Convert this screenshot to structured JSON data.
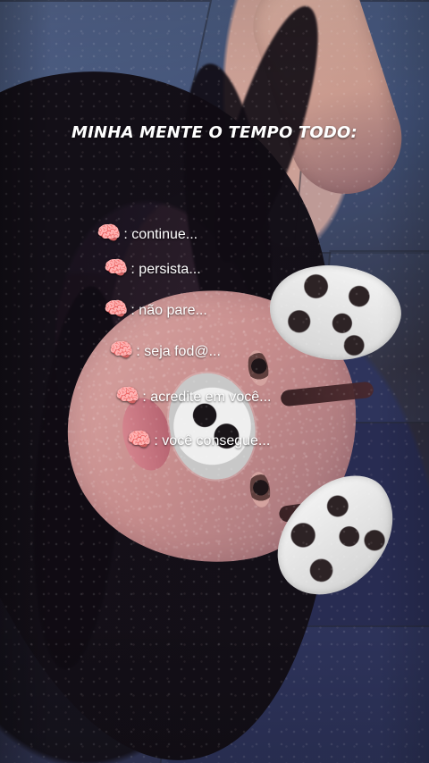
{
  "story": {
    "title": "MINHA MENTE O TEMPO TODO:",
    "emoji": "brain-emoji",
    "lines": [
      {
        "prefix": "🧠",
        "text": ": continue..."
      },
      {
        "prefix": "🧠",
        "text": ": persista..."
      },
      {
        "prefix": "🧠",
        "text": ": não pare..."
      },
      {
        "prefix": "🧠",
        "text": ": seja fod@..."
      },
      {
        "prefix": "🧠",
        "text": ": acredite em você..."
      },
      {
        "prefix": "🧠",
        "text": ": você consegue..."
      }
    ]
  }
}
